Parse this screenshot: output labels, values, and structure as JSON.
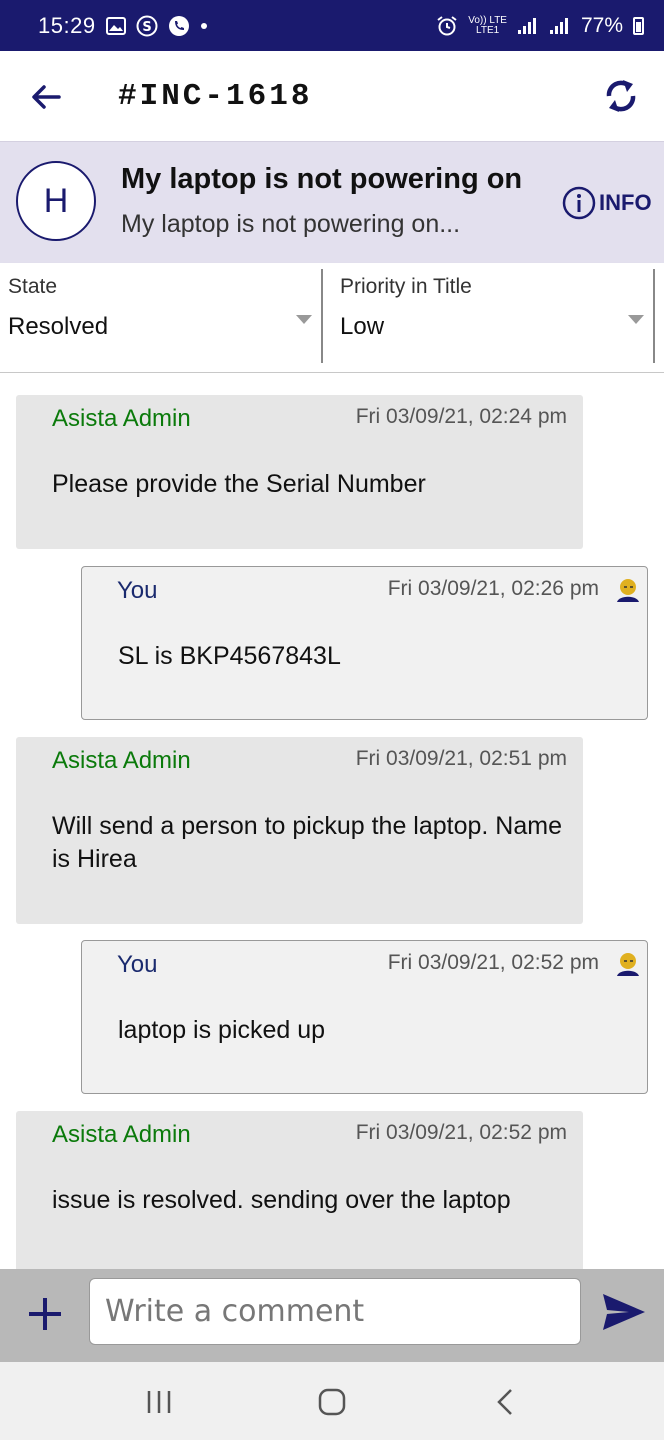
{
  "status_bar": {
    "time": "15:29",
    "network_top": "Vo)) LTE",
    "network_bottom": "LTE1",
    "battery": "77%"
  },
  "app_bar": {
    "ticket_id": "#INC-1618"
  },
  "ticket": {
    "avatar_letter": "H",
    "title": "My laptop is not powering on",
    "subtitle": "My laptop is not powering on...",
    "info_label": "INFO"
  },
  "fields": {
    "state_label": "State",
    "state_value": "Resolved",
    "priority_label": "Priority in Title",
    "priority_value": "Low"
  },
  "messages": [
    {
      "author": "Asista Admin",
      "time": "Fri 03/09/21, 02:24 pm",
      "text": "Please provide the Serial Number"
    },
    {
      "author": "You",
      "time": "Fri 03/09/21, 02:26 pm",
      "text": "SL is BKP4567843L"
    },
    {
      "author": "Asista Admin",
      "time": "Fri 03/09/21, 02:51 pm",
      "text": "Will send a person to pickup the laptop. Name is Hirea"
    },
    {
      "author": "You",
      "time": "Fri 03/09/21, 02:52 pm",
      "text": "laptop is picked up"
    },
    {
      "author": "Asista Admin",
      "time": "Fri 03/09/21, 02:52 pm",
      "text": "issue is resolved. sending over the laptop"
    }
  ],
  "composer": {
    "placeholder": "Write a comment"
  },
  "colors": {
    "primary": "#1a1a6e",
    "admin_name": "#0b7a0b",
    "header_bg": "#e3e0ee",
    "user_icon": "#e0b020"
  },
  "icons": {
    "back": "arrow-left-icon",
    "refresh": "refresh-icon",
    "info": "info-circle-icon",
    "add": "plus-icon",
    "send": "send-icon",
    "user": "user-avatar-icon"
  }
}
